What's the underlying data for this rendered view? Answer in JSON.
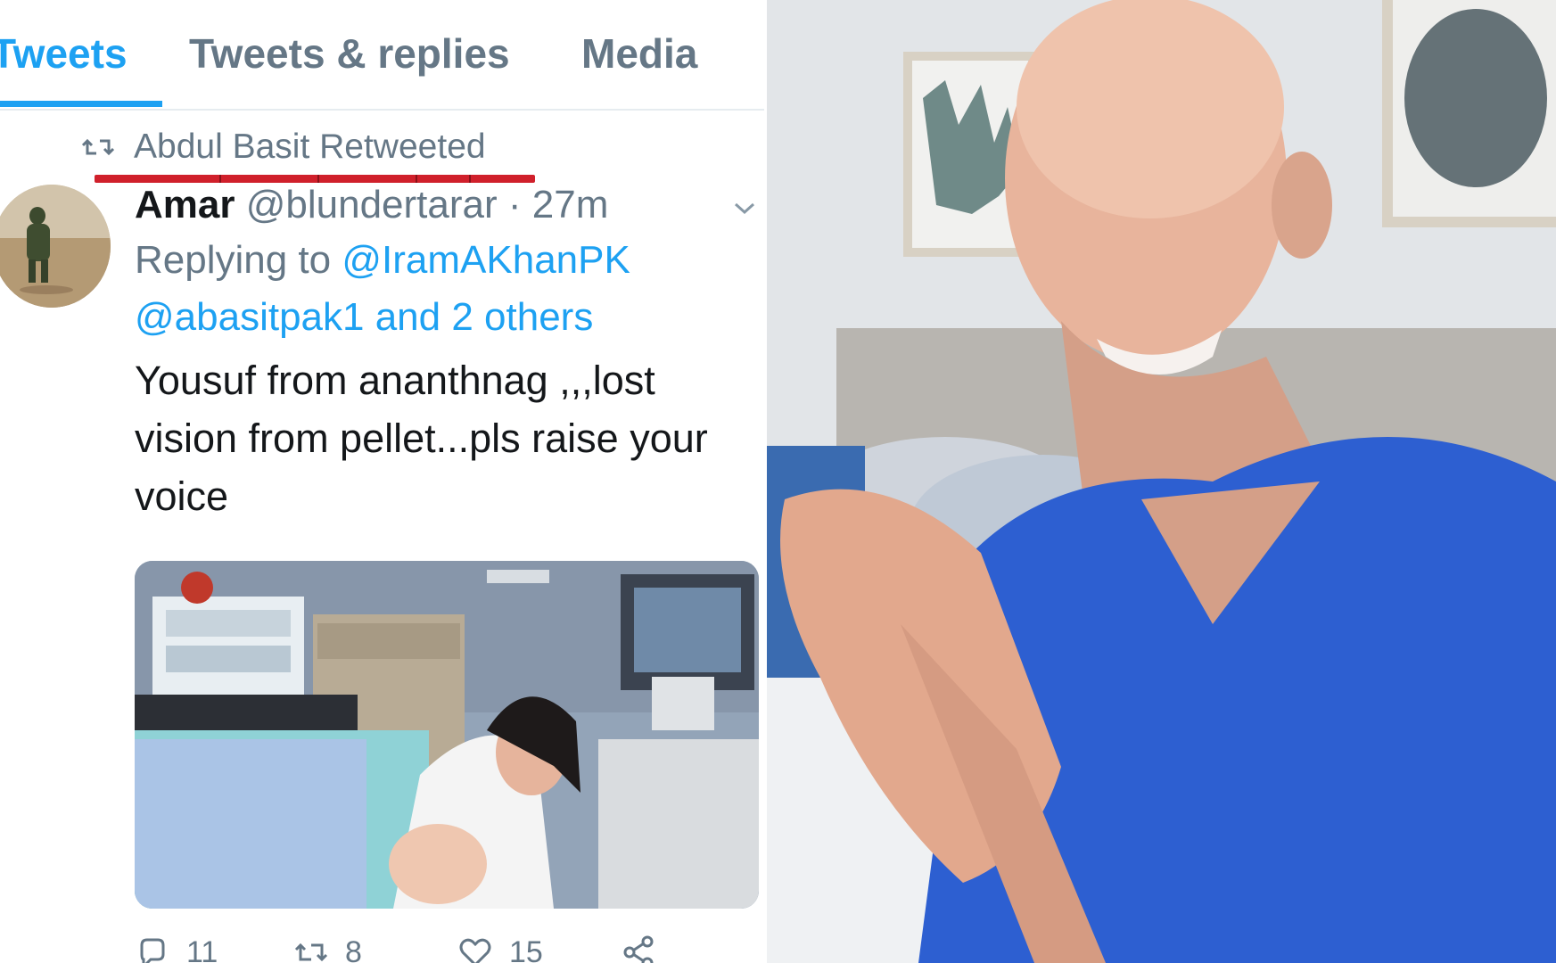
{
  "tabs": [
    {
      "label": "Tweets",
      "active": true
    },
    {
      "label": "Tweets & replies",
      "active": false
    },
    {
      "label": "Media",
      "active": false
    }
  ],
  "retweet": {
    "icon": "retweet-icon",
    "text": "Abdul Basit Retweeted"
  },
  "tweet": {
    "avatar": "avatar",
    "display_name": "Amar",
    "handle": "@blundertarar",
    "separator": " · ",
    "time": "27m",
    "reply_prefix": "Replying to ",
    "reply_mention_1": "@IramAKhanPK",
    "reply_mention_2": "@abasitpak1 and 2 others",
    "text": "Yousuf from ananthnag ,,,lost vision from pellet...pls raise your voice",
    "media": "attached-photo"
  },
  "actions": {
    "reply": {
      "icon": "reply-icon",
      "count": "11"
    },
    "retweet": {
      "icon": "retweet-icon",
      "count": "8"
    },
    "like": {
      "icon": "heart-icon",
      "count": "15"
    },
    "share": {
      "icon": "share-icon"
    }
  },
  "colors": {
    "accent": "#1da1f2",
    "text": "#14171a",
    "muted": "#657786",
    "highlight": "#d0202b"
  }
}
